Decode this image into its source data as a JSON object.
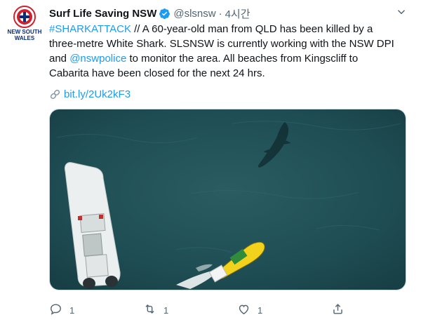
{
  "tweet": {
    "display_name": "Surf Life Saving NSW",
    "handle": "@slsnsw",
    "separator": "·",
    "time": "4시간",
    "avatar_text_line1": "NEW SOUTH",
    "avatar_text_line2": "WALES",
    "text_lines": [
      {
        "hashtag": "#SHARKATTACK",
        "rest": " // A 60-year-old man from QLD has been killed by a"
      },
      {
        "plain": "three-metre White Shark. SLSNSW is currently working with the NSW DPI"
      },
      {
        "before": "and ",
        "mention": "@nswpolice",
        "after": " to monitor the area. All beaches from Kingscliff to"
      },
      {
        "plain": "Cabarita have been closed for the next 24 hrs."
      }
    ],
    "link_text": "bit.ly/2Uk2kF3",
    "media_description_icon": "aerial-photo"
  },
  "actions": {
    "reply_count": "1",
    "retweet_count": "1",
    "like_count": "1"
  },
  "colors": {
    "accent": "#1d9bf0",
    "text": "#0f1419",
    "muted": "#536471",
    "ocean": "#1f4f55",
    "verified": "#1d9bf0",
    "avatar_red": "#d0202e"
  }
}
